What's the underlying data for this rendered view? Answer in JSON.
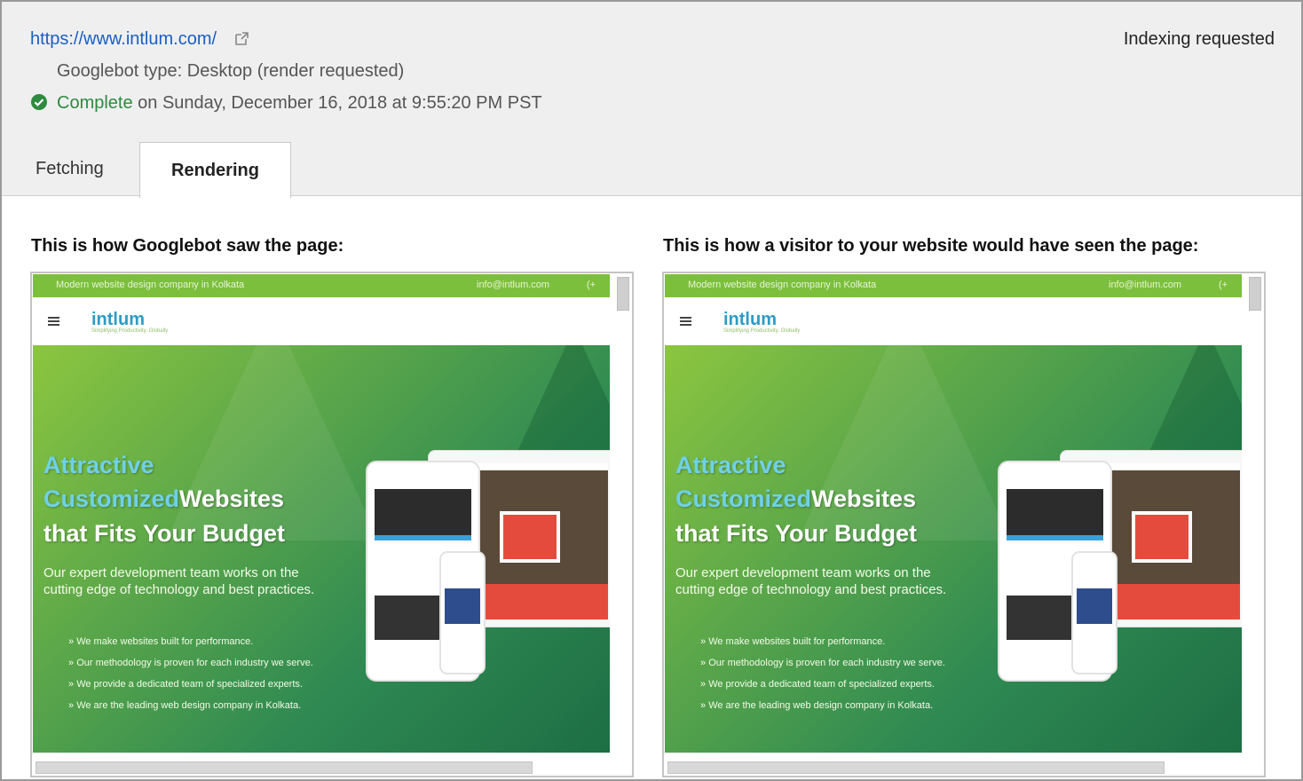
{
  "header": {
    "url": "https://www.intlum.com/",
    "indexing_status": "Indexing requested",
    "googlebot_type": "Googlebot type: Desktop (render requested)",
    "status_label": "Complete",
    "status_detail": " on Sunday, December 16, 2018 at 9:55:20 PM PST"
  },
  "tabs": [
    {
      "label": "Fetching",
      "active": false
    },
    {
      "label": "Rendering",
      "active": true
    }
  ],
  "captions": {
    "googlebot": "This is how Googlebot saw the page:",
    "visitor": "This is how a visitor to your website would have seen the page:"
  },
  "preview": {
    "topbar_left": "Modern website design company in Kolkata",
    "topbar_email": "info@intlum.com",
    "topbar_phone": "(+",
    "logo_text": "intlum",
    "logo_tagline": "Simplifying Productivity. Globally",
    "headline_1": "Attractive",
    "headline_2a": "Customized",
    "headline_2b": "Websites",
    "headline_3": "that Fits Your Budget",
    "description": "Our expert development team works on the cutting edge of technology and best practices.",
    "bullets": [
      "We make websites built for performance.",
      "Our methodology is proven for each industry we serve.",
      "We provide a dedicated team of specialized experts.",
      "We are the leading web design company in Kolkata."
    ]
  },
  "colors": {
    "link": "#1a5fc4",
    "success": "#2e8b3f",
    "brand_green": "#7cbf3c",
    "hero_dark": "#1d6e44",
    "headline_highlight": "#6fd0e8"
  }
}
